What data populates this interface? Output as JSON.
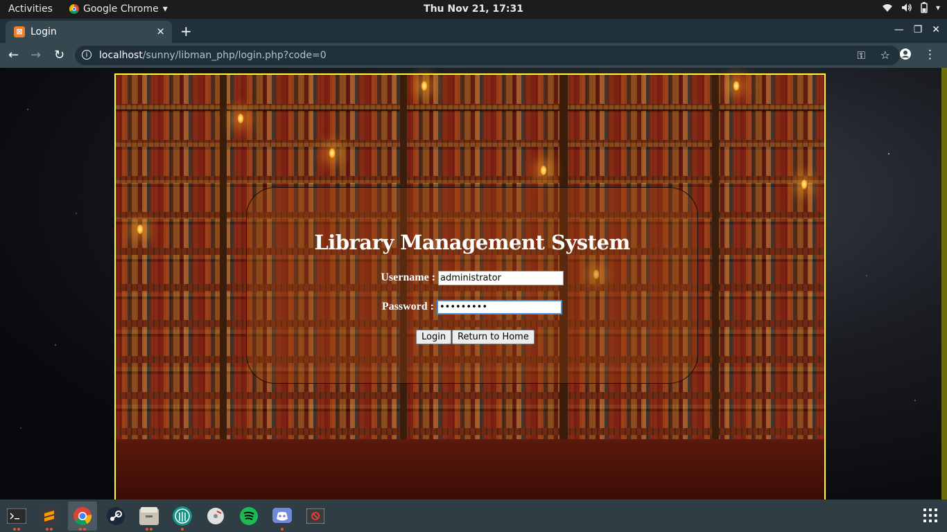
{
  "topbar": {
    "activities": "Activities",
    "app_name": "Google Chrome",
    "clock": "Thu Nov 21, 17:31"
  },
  "tab": {
    "favicon_text": "⊠",
    "title": "Login",
    "close": "×"
  },
  "toolbar": {
    "url_host": "localhost",
    "url_path": "/sunny/libman_php/login.php?code=0"
  },
  "page": {
    "title": "Library Management System",
    "username_label": "Username :",
    "username_value": "administrator",
    "password_label": "Password :",
    "password_value": "•••••••••",
    "login_button": "Login",
    "home_button": "Return to Home"
  },
  "colors": {
    "panel_border": "#ffff33",
    "tab_bg": "#35474f",
    "taskbar_bg": "#2e3e44"
  },
  "taskbar": {
    "apps": [
      "terminal-icon",
      "sublime-text-icon",
      "chrome-icon",
      "steam-icon",
      "files-icon",
      "gitkraken-icon",
      "disk-icon",
      "spotify-icon",
      "discord-icon",
      "screen-recorder-icon"
    ]
  }
}
